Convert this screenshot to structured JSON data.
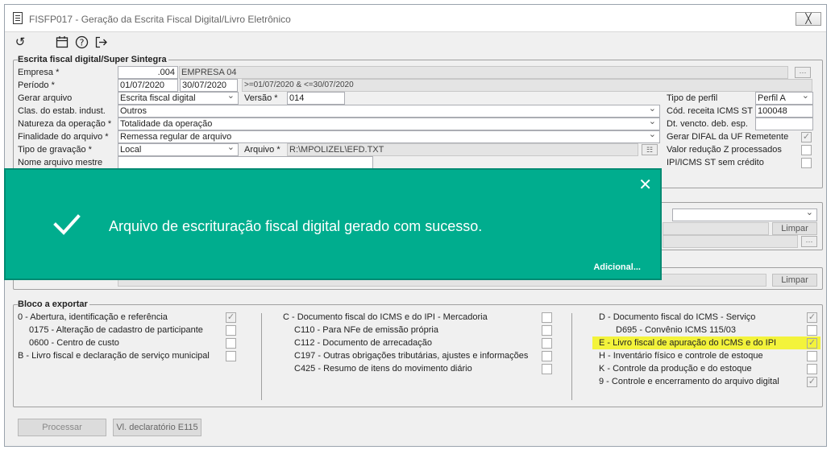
{
  "window": {
    "title": "FISFP017 - Geração da Escrita Fiscal Digital/Livro Eletrônico",
    "close_label": "╳"
  },
  "toolbar": {
    "icons": [
      "undo-icon",
      "calendar-icon",
      "help-icon",
      "exit-icon"
    ]
  },
  "escrita": {
    "title": "Escrita fiscal digital/Super Sintegra",
    "empresa_label": "Empresa *",
    "empresa_code": ".004",
    "empresa_name": "EMPRESA 04",
    "periodo_label": "Período *",
    "periodo_ini": "01/07/2020",
    "periodo_fim": "30/07/2020",
    "periodo_expr": ">=01/07/2020 & <=30/07/2020",
    "gerar_label": "Gerar arquivo",
    "gerar_value": "Escrita fiscal digital",
    "versao_label": "Versão *",
    "versao_value": "014",
    "clas_label": "Clas. do estab. indust.",
    "clas_value": "Outros",
    "natureza_label": "Natureza da operação *",
    "natureza_value": "Totalidade da operação",
    "finalidade_label": "Finalidade do arquivo *",
    "finalidade_value": "Remessa regular de arquivo",
    "tipo_grav_label": "Tipo de gravação *",
    "tipo_grav_value": "Local",
    "arquivo_label": "Arquivo *",
    "arquivo_value": "R:\\MPOLIZEL\\EFD.TXT",
    "nome_mestre_label": "Nome arquivo mestre",
    "tipo_perfil_label": "Tipo de perfil",
    "tipo_perfil_value": "Perfil A",
    "cod_receita_label": "Cód. receita ICMS ST",
    "cod_receita_value": "100048",
    "dt_vencto_label": "Dt. vencto. deb. esp.",
    "gerar_difal_label": "Gerar DIFAL da UF Remetente",
    "valor_reducao_label": "Valor redução Z processados",
    "ipi_label": "IPI/ICMS ST sem crédito"
  },
  "mid": {
    "limpar1": "Limpar",
    "limpar2": "Limpar"
  },
  "bloco": {
    "title": "Bloco a exportar",
    "col1": [
      {
        "label": "0 - Abertura, identificação e referência",
        "checked": true
      },
      {
        "label": "0175 - Alteração de cadastro de participante",
        "checked": false
      },
      {
        "label": "0600 - Centro de custo",
        "checked": false
      },
      {
        "label": "B - Livro fiscal e declaração de serviço municipal",
        "checked": false
      }
    ],
    "col2": [
      {
        "label": "C - Documento fiscal do ICMS e do IPI - Mercadoria",
        "checked": false
      },
      {
        "label": "C110 - Para NFe de emissão própria",
        "checked": false
      },
      {
        "label": "C112 - Documento de arrecadação",
        "checked": false
      },
      {
        "label": "C197 - Outras obrigações tributárias, ajustes e informações",
        "checked": false
      },
      {
        "label": "C425 - Resumo de itens do movimento diário",
        "checked": false
      }
    ],
    "col3": [
      {
        "label": "D - Documento fiscal do ICMS - Serviço",
        "checked": true
      },
      {
        "label": "D695 - Convênio ICMS 115/03",
        "checked": false
      },
      {
        "label": "E - Livro fiscal de apuração do ICMS e do IPI",
        "checked": true
      },
      {
        "label": "H - Inventário físico e controle de estoque",
        "checked": false
      },
      {
        "label": "K - Controle da produção e do estoque",
        "checked": false
      },
      {
        "label": "9 - Controle e encerramento do arquivo digital",
        "checked": true
      }
    ]
  },
  "footer": {
    "processar": "Processar",
    "vl_declaratorio": "Vl. declaratório E115"
  },
  "toast": {
    "message": "Arquivo de escrituração fiscal digital gerado com sucesso.",
    "more": "Adicional...",
    "close": "✕"
  }
}
